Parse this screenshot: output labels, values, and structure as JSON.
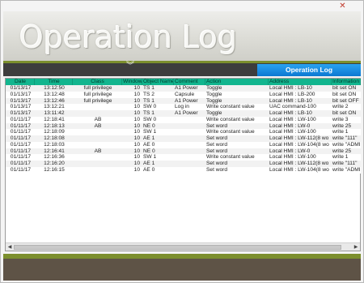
{
  "window": {
    "close_glyph": "✕"
  },
  "header": {
    "title": "Operation Log"
  },
  "nav": {
    "chevron_glyph": "︾",
    "tab_label": "Operation Log"
  },
  "colors": {
    "accent_green": "#7c8f2d",
    "header_teal": "#12b58e",
    "tab_blue": "#1a8ee3",
    "footer_brown": "#5e5346"
  },
  "table": {
    "columns": [
      "Date",
      "Time",
      "Class",
      "Window",
      "Object Name",
      "Comment",
      "Action",
      "Address",
      "Information"
    ],
    "rows": [
      [
        "01/13/17",
        "13:12:50",
        "full privilege",
        "10",
        "TS  1",
        "A1 Power",
        "Toggle",
        "Local HMI : LB-10",
        "bit set ON"
      ],
      [
        "01/13/17",
        "13:12:48",
        "full privilege",
        "10",
        "TS  2",
        "Capsule",
        "Toggle",
        "Local HMI : LB-200",
        "bit set ON"
      ],
      [
        "01/13/17",
        "13:12:46",
        "full privilege",
        "10",
        "TS  1",
        "A1 Power",
        "Toggle",
        "Local HMI : LB-10",
        "bit set OFF"
      ],
      [
        "01/13/17",
        "13:12:21",
        "",
        "10",
        "SW  0",
        "Log in",
        "Write constant value",
        "UAC command-100",
        "write 2"
      ],
      [
        "01/13/17",
        "13:11:42",
        "",
        "10",
        "TS  1",
        "A1 Power",
        "Toggle",
        "Local HMI : LB-10",
        "bit set ON"
      ],
      [
        "01/11/17",
        "12:18:41",
        "AB",
        "10",
        "SW  0",
        "",
        "Write constant value",
        "Local HMI : LW-100",
        "write 3"
      ],
      [
        "01/11/17",
        "12:18:13",
        "AB",
        "10",
        "NE  0",
        "",
        "Set word",
        "Local HMI : LW-0",
        "write 25"
      ],
      [
        "01/11/17",
        "12:18:09",
        "",
        "10",
        "SW  1",
        "",
        "Write constant value",
        "Local HMI : LW-100",
        "write 1"
      ],
      [
        "01/11/17",
        "12:18:08",
        "",
        "10",
        "AE  1",
        "",
        "Set word",
        "Local HMI : LW-112(8 wo",
        "write \"111\""
      ],
      [
        "01/11/17",
        "12:18:03",
        "",
        "10",
        "AE  0",
        "",
        "Set word",
        "Local HMI : LW-104(8 wo",
        "write \"ADMIN\""
      ],
      [
        "01/11/17",
        "12:16:41",
        "AB",
        "10",
        "NE  0",
        "",
        "Set word",
        "Local HMI : LW-0",
        "write 25"
      ],
      [
        "01/11/17",
        "12:16:36",
        "",
        "10",
        "SW  1",
        "",
        "Write constant value",
        "Local HMI : LW-100",
        "write 1"
      ],
      [
        "01/11/17",
        "12:16:20",
        "",
        "10",
        "AE  1",
        "",
        "Set word",
        "Local HMI : LW-112(8 wo",
        "write \"111\""
      ],
      [
        "01/11/17",
        "12:16:15",
        "",
        "10",
        "AE  0",
        "",
        "Set word",
        "Local HMI : LW-104(8 wo",
        "write \"ADMIN\""
      ]
    ]
  },
  "scrollbar": {
    "left_glyph": "◀",
    "right_glyph": "▶"
  }
}
